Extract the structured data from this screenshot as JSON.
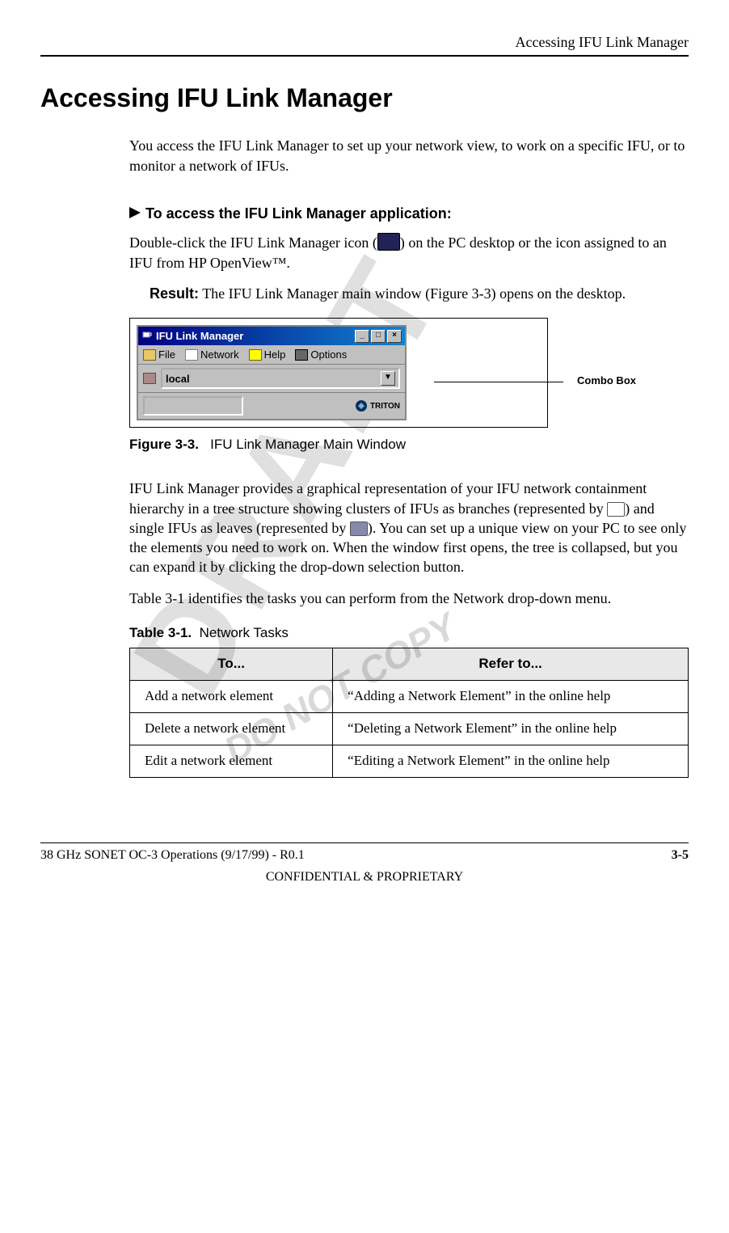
{
  "header": {
    "section_title": "Accessing IFU Link Manager"
  },
  "title": "Accessing IFU Link Manager",
  "intro": "You access the IFU Link Manager to set up your network view, to work on a specific IFU, or to monitor a network of IFUs.",
  "proc_heading": "To access the IFU Link Manager application:",
  "step1_a": "Double-click the IFU Link Manager icon (",
  "step1_b": ") on the PC desktop or the icon assigned to an IFU from HP OpenView™.",
  "result_label": "Result:",
  "result_text": " The IFU Link Manager main window (Figure 3-3) opens on the desktop.",
  "window": {
    "title": "IFU Link Manager",
    "menu": {
      "file": "File",
      "network": "Network",
      "help": "Help",
      "options": "Options"
    },
    "combo_value": "local",
    "brand": "TRITON"
  },
  "callout": "Combo Box",
  "figure": {
    "num": "Figure 3-3.",
    "caption": "IFU Link Manager Main Window"
  },
  "para2_a": "IFU Link Manager provides a graphical representation of your IFU network containment hierarchy in a tree structure showing clusters of IFUs as branches (represented by ",
  "para2_b": ") and single IFUs as leaves (represented by ",
  "para2_c": "). You can set up a unique view on your PC to see only the elements you need to work on. When the window first opens, the tree is collapsed, but you can expand it by clicking the drop-down selection button.",
  "para3": "Table 3-1 identifies the tasks you can perform from the Network drop-down menu.",
  "table": {
    "num": "Table 3-1.",
    "caption": "Network Tasks",
    "h1": "To...",
    "h2": "Refer to...",
    "rows": [
      {
        "to": "Add a network element",
        "ref": "“Adding a Network Element” in the online help"
      },
      {
        "to": "Delete a network element",
        "ref": "“Deleting a Network Element” in the online help"
      },
      {
        "to": "Edit a network element",
        "ref": "“Editing a Network Element” in the online help"
      }
    ]
  },
  "footer": {
    "left": "38 GHz SONET OC-3 Operations  (9/17/99) - R0.1",
    "page": "3-5",
    "classification": "CONFIDENTIAL & PROPRIETARY"
  },
  "watermark": "DRAFT",
  "watermark2": "DO NOT COPY"
}
